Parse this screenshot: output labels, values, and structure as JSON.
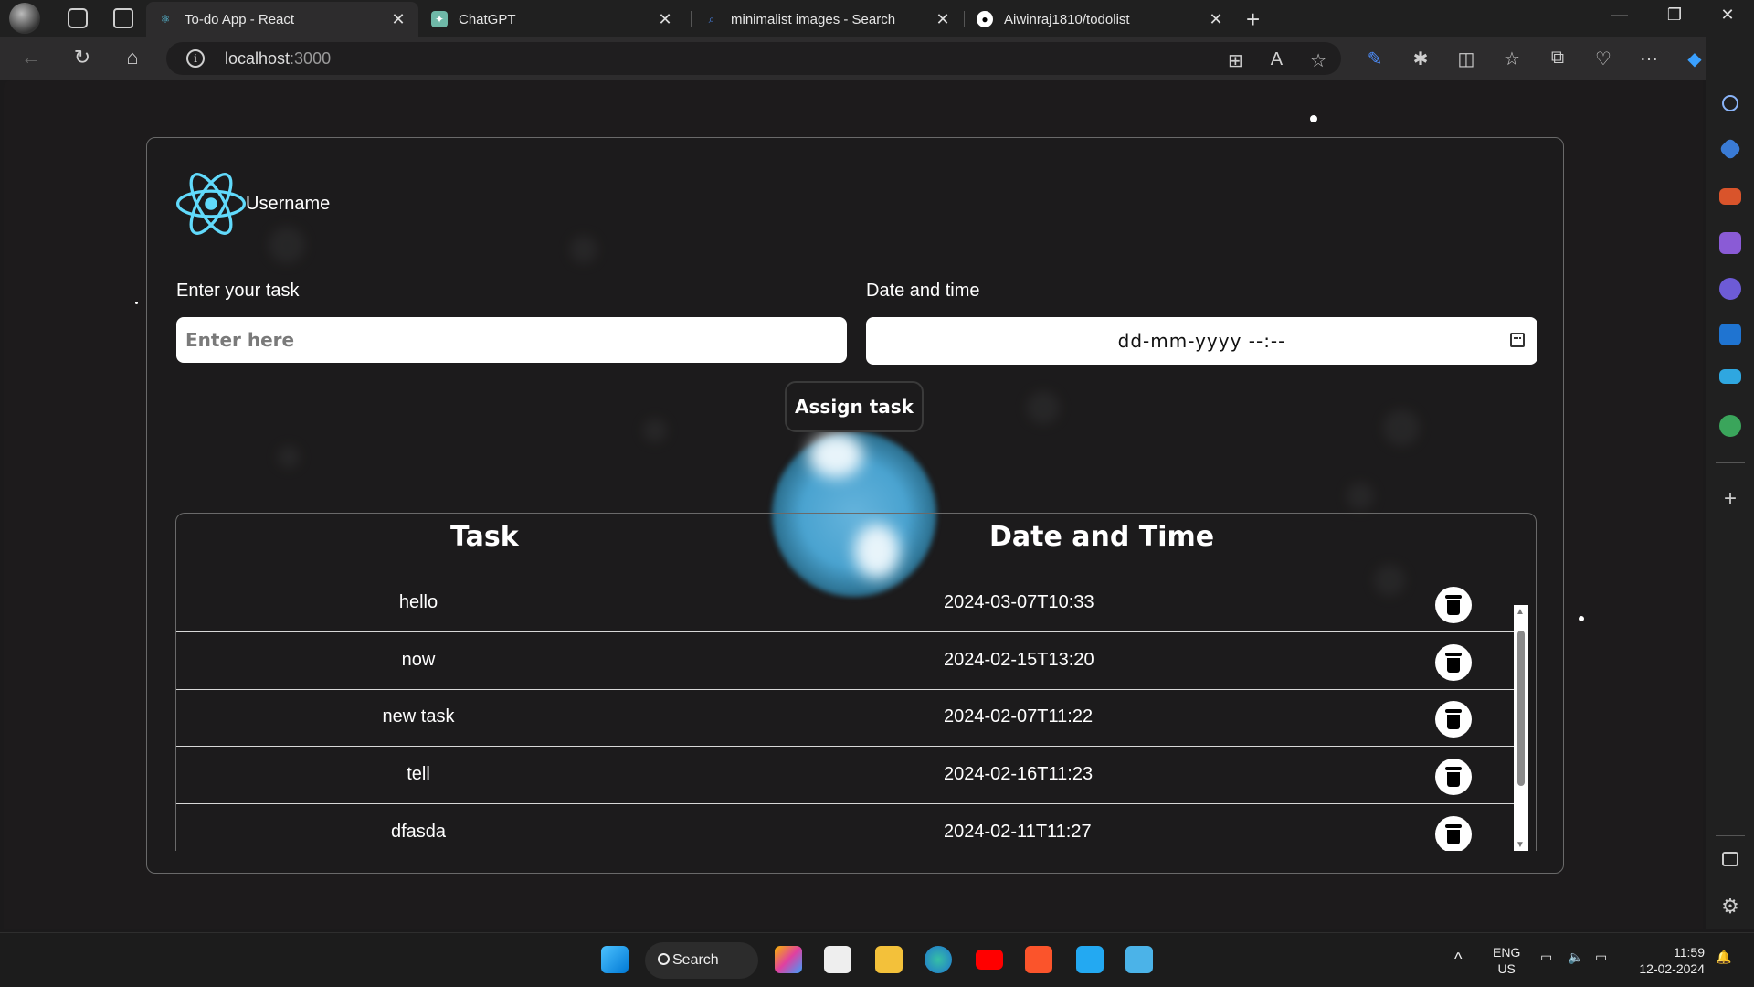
{
  "browser": {
    "tabs": [
      {
        "title": "To-do App - React",
        "active": true,
        "icon": "react-icon"
      },
      {
        "title": "ChatGPT",
        "active": false,
        "icon": "chatgpt-icon"
      },
      {
        "title": "minimalist images - Search",
        "active": false,
        "icon": "search-icon"
      },
      {
        "title": "Aiwinraj1810/todolist",
        "active": false,
        "icon": "github-icon"
      }
    ],
    "url_host": "localhost",
    "url_port": ":3000"
  },
  "app": {
    "username": "Username",
    "task_label": "Enter your task",
    "task_placeholder": "Enter here",
    "date_label": "Date and time",
    "date_placeholder": "dd-mm-yyyy --:--",
    "assign_label": "Assign task",
    "table": {
      "headers": [
        "Task",
        "Date and Time"
      ],
      "rows": [
        {
          "task": "hello",
          "datetime": "2024-03-07T10:33"
        },
        {
          "task": "now",
          "datetime": "2024-02-15T13:20"
        },
        {
          "task": "new task",
          "datetime": "2024-02-07T11:22"
        },
        {
          "task": "tell",
          "datetime": "2024-02-16T11:23"
        },
        {
          "task": "dfasda",
          "datetime": "2024-02-11T11:27"
        }
      ]
    }
  },
  "taskbar": {
    "search_label": "Search",
    "lang": "ENG",
    "region": "US",
    "time": "11:59",
    "date": "12-02-2024"
  },
  "colors": {
    "accent": "#61dafb",
    "page_bg": "#1d1b1c"
  }
}
